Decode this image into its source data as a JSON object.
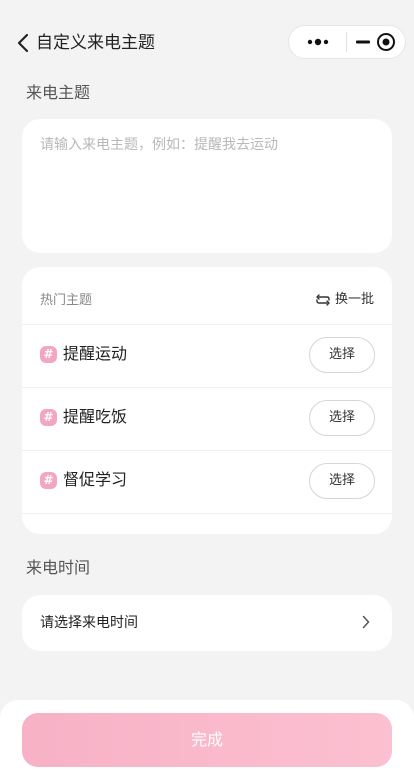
{
  "header": {
    "title": "自定义来电主题"
  },
  "theme": {
    "label": "来电主题",
    "placeholder": "请输入来电主题，例如：提醒我去运动",
    "value": ""
  },
  "hot": {
    "title": "热门主题",
    "refresh_label": "换一批",
    "items": [
      {
        "hash": "#",
        "label": "提醒运动",
        "action": "选择"
      },
      {
        "hash": "#",
        "label": "提醒吃饭",
        "action": "选择"
      },
      {
        "hash": "#",
        "label": "督促学习",
        "action": "选择"
      }
    ]
  },
  "time": {
    "label": "来电时间",
    "placeholder": "请选择来电时间"
  },
  "footer": {
    "done_label": "完成"
  },
  "colors": {
    "accent": "#f8b1c6",
    "hash_bg": "#f3a6c3",
    "background": "#f3f3f3"
  }
}
